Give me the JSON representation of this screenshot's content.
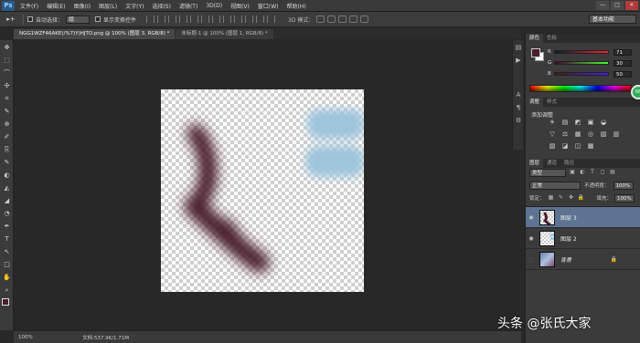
{
  "menubar": {
    "logo": "Ps",
    "items": [
      "文件(F)",
      "编辑(E)",
      "图像(I)",
      "图层(L)",
      "文字(Y)",
      "选择(S)",
      "滤镜(T)",
      "3D(D)",
      "视图(V)",
      "窗口(W)",
      "帮助(H)"
    ],
    "minimize": "—",
    "maximize": "□",
    "close": "✕"
  },
  "options": {
    "tool_glyph": "▸+",
    "auto_select_label": "自动选择：",
    "auto_select_value": "组",
    "show_transform_label": "显示变换控件",
    "mode_3d_label": "3D 模式：",
    "workspace": "基本功能"
  },
  "tabs": [
    {
      "label": "NGG1WZF46AKE(/%7)Y)HJTO.png @ 100% (图层 3, RGB/8) *",
      "active": true
    },
    {
      "label": "未标题-1 @ 100% (图层 1, RGB/8) *",
      "active": false
    }
  ],
  "tools": [
    "✥",
    "⬚",
    "⌒",
    "✣",
    "⌗",
    "✎",
    "⊕",
    "✐",
    "⎘",
    "✎",
    "◐",
    "◭",
    "◢",
    "◔",
    "✒",
    "T",
    "↖",
    "□",
    "✋",
    "⌕"
  ],
  "status": {
    "zoom": "100%",
    "doc": "文档:537.9K/1.71M"
  },
  "color_panel": {
    "tabs": [
      "颜色",
      "色板"
    ],
    "foreground": "#4a1e2c",
    "background": "#ffffff",
    "r_label": "R",
    "r_value": "71",
    "g_label": "G",
    "g_value": "30",
    "b_label": "B",
    "b_value": "50"
  },
  "adjustments": {
    "tabs": [
      "调整",
      "样式"
    ],
    "title": "添加调整",
    "icons": [
      [
        "☀",
        "▤",
        "◩",
        "▣",
        "◒"
      ],
      [
        "▽",
        "⚖",
        "▦",
        "◎",
        "▧",
        "▥"
      ],
      [
        "▨",
        "◪",
        "◫",
        "▩"
      ]
    ]
  },
  "layers": {
    "tabs": [
      "图层",
      "通道",
      "路径"
    ],
    "filter_kind": "类型",
    "blend_mode": "正常",
    "opacity_label": "不透明度：",
    "opacity_value": "100%",
    "lock_label": "锁定：",
    "fill_label": "填充：",
    "fill_value": "100%",
    "items": [
      {
        "name": "图层 3",
        "visible": true,
        "selected": true
      },
      {
        "name": "图层 2",
        "visible": true,
        "selected": false
      },
      {
        "name": "背景",
        "visible": false,
        "selected": false,
        "locked": true
      }
    ]
  },
  "badge": "66",
  "watermark": "头条 @张氏大家"
}
